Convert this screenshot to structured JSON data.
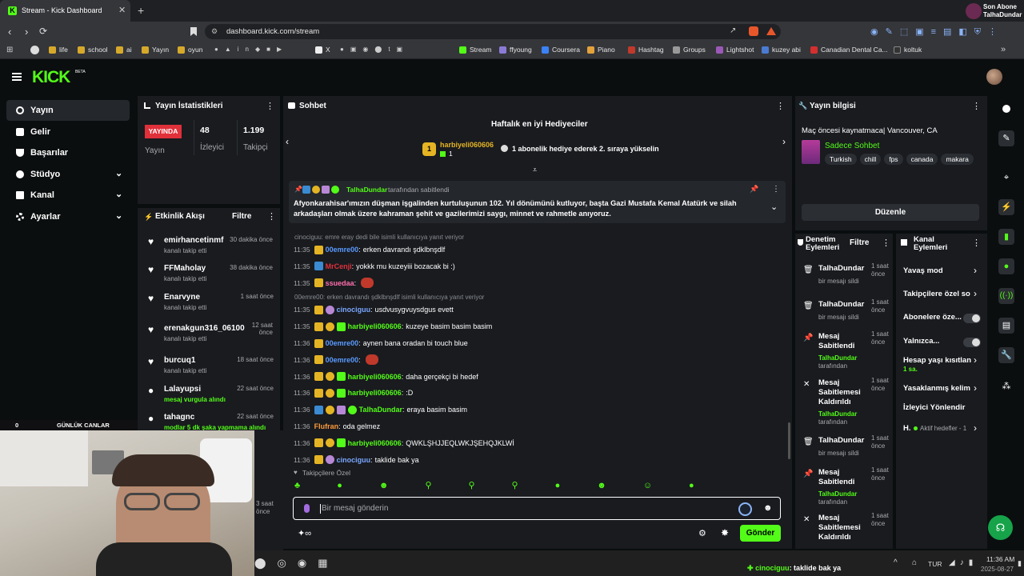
{
  "browser": {
    "tab_title": "Stream - Kick Dashboard",
    "url": "dashboard.kick.com/stream",
    "profile_line1": "Son Abone",
    "profile_line2": "TalhaDundar",
    "bookmarks": [
      "life",
      "school",
      "ai",
      "Yayın",
      "oyun",
      "X",
      "Stream",
      "ffyoung",
      "Coursera",
      "Piano",
      "Hashtag",
      "Groups",
      "Lightshot",
      "kuzey abi",
      "Canadian Dental Ca...",
      "koltuk"
    ]
  },
  "header": {
    "logo": "KICK",
    "beta": "BETA"
  },
  "nav": {
    "items": [
      {
        "label": "Yayın"
      },
      {
        "label": "Gelir"
      },
      {
        "label": "Başarılar"
      },
      {
        "label": "Stüdyo"
      },
      {
        "label": "Kanal"
      },
      {
        "label": "Ayarlar"
      }
    ]
  },
  "stats": {
    "title": "Yayın İstatistikleri",
    "live_badge": "YAYINDA",
    "live_label": "Yayın",
    "viewers": "48",
    "viewers_label": "İzleyici",
    "followers": "1.199",
    "followers_label": "Takipçi"
  },
  "activity": {
    "title": "Etkinlik Akışı",
    "filter": "Filtre",
    "items": [
      {
        "name": "emirhancetinmf",
        "time": "30 dakika önce",
        "desc": "kanalı takip etti"
      },
      {
        "name": "FFMaholay",
        "time": "38 dakika önce",
        "desc": "kanalı takip etti"
      },
      {
        "name": "Enarvyne",
        "time": "1 saat önce",
        "desc": "kanalı takip etti"
      },
      {
        "name": "erenakgun316_06100",
        "time": "12 saat önce",
        "desc": "kanalı takip etti"
      },
      {
        "name": "burcuq1",
        "time": "18 saat önce",
        "desc": "kanalı takip etti"
      },
      {
        "name": "Lalayupsi",
        "time": "22 saat önce",
        "desc": "mesaj vurgula alındı"
      },
      {
        "name": "tahagnc",
        "time": "22 saat önce",
        "desc": "modlar 5 dk şaka yapmama alındı"
      }
    ],
    "overlay_left": "0",
    "overlay_title": "GÜNLÜK CANLAR"
  },
  "chat": {
    "title": "Sohbet",
    "top_gifters_title": "Haftalık en iyi Hediyeciler",
    "gifter_name": "harbiyeli060606",
    "gifter_count": "1",
    "gifter_rank": "1",
    "gifter_note": "1 abonelik hediye ederek 2. sıraya yükselin",
    "pinned_by": "TalhaDundar",
    "pinned_suffix": "tarafından sabitlendi",
    "pinned_text": "Afyonkarahisar'ımızın düşman işgalinden kurtuluşunun 102. Yıl dönümünü kutluyor, başta Gazi Mustafa Kemal Atatürk ve silah arkadaşları olmak üzere kahraman şehit ve gazilerimizi saygı, minnet ve rahmetle anıyoruz.",
    "messages": [
      {
        "reply": "cinociguu: emre eray dedi bile isimli kullanıcıya yanıt veriyor"
      },
      {
        "time": "11:35",
        "user": "00emre00",
        "color": "#5a9bff",
        "text": "erken davrandı şdklbnşdlf"
      },
      {
        "time": "11:35",
        "user": "MrCenji",
        "color": "#e0303a",
        "text": "yokkk mu kuzeyiii bozacak bi :)"
      },
      {
        "time": "11:35",
        "user": "ssuedaa",
        "color": "#ff6fae",
        "text": ""
      },
      {
        "reply": "00emre00: erken davrandı şdklbnşdlf isimli kullanıcıya yanıt veriyor"
      },
      {
        "time": "11:35",
        "user": "cinociguu",
        "color": "#7aa7ff",
        "text": "usdvusygvuysdgus evett"
      },
      {
        "time": "11:35",
        "user": "harbiyeli060606",
        "color": "#53fc18",
        "text": "kuzeye basim basim basim"
      },
      {
        "time": "11:36",
        "user": "00emre00",
        "color": "#5a9bff",
        "text": "aynen bana oradan bi touch blue"
      },
      {
        "time": "11:36",
        "user": "00emre00",
        "color": "#5a9bff",
        "text": ""
      },
      {
        "time": "11:36",
        "user": "harbiyeli060606",
        "color": "#53fc18",
        "text": "daha gerçekçi bi hedef"
      },
      {
        "time": "11:36",
        "user": "harbiyeli060606",
        "color": "#53fc18",
        "text": ":D"
      },
      {
        "time": "11:36",
        "user": "TalhaDundar",
        "color": "#53fc18",
        "text": "eraya basim basim"
      },
      {
        "time": "11:36",
        "user": "Flufran",
        "color": "#ff9b3b",
        "text": "oda gelmez"
      },
      {
        "time": "11:36",
        "user": "harbiyeli060606",
        "color": "#53fc18",
        "text": "QWKLŞHJJEQLWKJŞEHQJKLWİ"
      },
      {
        "time": "11:36",
        "user": "cinociguu",
        "color": "#7aa7ff",
        "text": "taklide bak ya"
      }
    ],
    "followers_only": "Takipçilere Özel",
    "input_placeholder": "Bir mesaj gönderin",
    "send": "Gönder"
  },
  "stream_info": {
    "title": "Yayın bilgisi",
    "stream_title": "Maç öncesi kaynatmaca| Vancouver, CA",
    "category": "Sadece Sohbet",
    "tags": [
      "Turkish",
      "chill",
      "fps",
      "canada",
      "makara"
    ],
    "edit": "Düzenle"
  },
  "mod_actions": {
    "title_line1": "Denetim",
    "title_line2": "Eylemleri",
    "filter": "Filtre",
    "items": [
      {
        "title": "TalhaDundar",
        "sub": "bir mesajı sildi",
        "by": "",
        "suffix": "",
        "time1": "1 saat",
        "time2": "önce"
      },
      {
        "title": "TalhaDundar",
        "sub": "bir mesajı sildi",
        "by": "",
        "suffix": "",
        "time1": "1 saat",
        "time2": "önce"
      },
      {
        "title": "Mesaj Sabitlendi",
        "sub": "",
        "by": "TalhaDundar",
        "suffix": "tarafından",
        "time1": "1 saat",
        "time2": "önce"
      },
      {
        "title": "Mesaj Sabitlemesi Kaldırıldı",
        "sub": "",
        "by": "TalhaDundar",
        "suffix": "tarafından",
        "time1": "1 saat",
        "time2": "önce"
      },
      {
        "title": "TalhaDundar",
        "sub": "bir mesajı sildi",
        "by": "",
        "suffix": "",
        "time1": "1 saat",
        "time2": "önce"
      },
      {
        "title": "Mesaj Sabitlendi",
        "sub": "",
        "by": "TalhaDundar",
        "suffix": "tarafından",
        "time1": "1 saat",
        "time2": "önce"
      },
      {
        "title": "Mesaj Sabitlemesi Kaldırıldı",
        "sub": "",
        "by": "",
        "suffix": "",
        "time1": "1 saat",
        "time2": "önce"
      }
    ]
  },
  "channel_actions": {
    "title_line1": "Kanal",
    "title_line2": "Eylemleri",
    "items": [
      {
        "label": "Yavaş mod",
        "sub": ""
      },
      {
        "label": "Takipçilere özel so",
        "sub": ""
      },
      {
        "label": "Abonelere öze...",
        "sub": ""
      },
      {
        "label": "Yalnızca...",
        "sub": ""
      },
      {
        "label": "Hesap yaşı kısıtlan",
        "sub": "1 sa."
      },
      {
        "label": "Yasaklanmış kelim",
        "sub": ""
      },
      {
        "label": "İzleyici Yönlendir",
        "sub": ""
      },
      {
        "label": "H.",
        "sub": "Aktif hedefler - 1"
      }
    ]
  },
  "taskbar": {
    "ticker_user": "cinociguu",
    "ticker_text": ": taklide bak ya",
    "lang": "TUR",
    "time": "11:36 AM",
    "date": "2025-08-27"
  },
  "colors": {
    "accent": "#53fc18",
    "live": "#e0303a",
    "panel": "#191b1f"
  }
}
